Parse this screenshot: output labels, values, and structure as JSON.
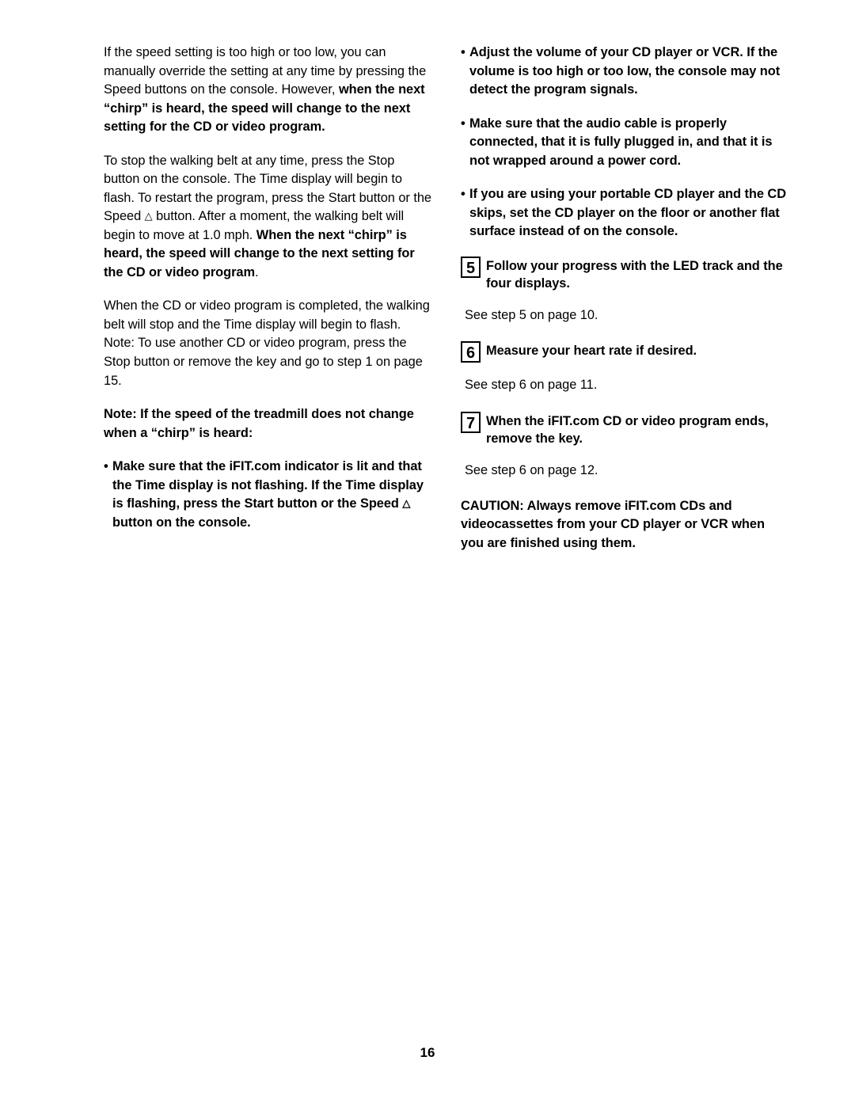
{
  "page": {
    "number": "16"
  },
  "left_column": {
    "para1_part1": "If the speed setting is too high or too low, you can manually override the setting at any time by pressing the Speed buttons on the console. However, ",
    "para1_bold": "when the next “chirp” is heard, the speed will change to the next setting for the CD or video program.",
    "para2_part1": "To stop the walking belt at any time, press the Stop button on the console. The Time display will begin to flash. To restart the program, press the Start button or the Speed ",
    "para2_tri": "△",
    "para2_part2": " button. After a moment, the walking belt will begin to move at 1.0 mph. ",
    "para2_bold": "When the next “chirp” is heard, the speed will change to the next setting for the CD or video program",
    "para2_end": ".",
    "para3": "When the CD or video program is completed, the walking belt will stop and the Time display will begin to flash. Note: To use another CD or video program, press the Stop button or remove the key and go to step 1 on page 15.",
    "note_heading": "Note: If the speed of the treadmill does not change when a “chirp” is heard:",
    "bullet_dot": "•",
    "bullet1_part1": "Make sure that the iFIT.com indicator is lit and that the Time display is not flashing. If the Time display is flashing, press the Start button or the Speed ",
    "bullet1_tri": "△",
    "bullet1_part2": " button on the console."
  },
  "right_column": {
    "bullet_dot": "•",
    "bullet1": "Adjust the volume of your CD player or VCR. If the volume is too high or too low, the console may not detect the program signals.",
    "bullet2": "Make sure that the audio cable is properly connected, that it is fully plugged in, and that it is not wrapped around a power cord.",
    "bullet3": "If you are using your portable CD player and the CD skips, set the CD player on the floor or another flat surface instead of on the console.",
    "step5_num": "5",
    "step5_text": "Follow your progress with the LED track and the four displays.",
    "step5_ref": "See step 5 on page 10.",
    "step6_num": "6",
    "step6_text": "Measure your heart rate if desired.",
    "step6_ref": "See step 6 on page 11.",
    "step7_num": "7",
    "step7_text": "When the iFIT.com CD or video program ends, remove the key.",
    "step7_ref": "See step 6 on page 12.",
    "caution": "CAUTION: Always remove iFIT.com CDs and videocassettes from your CD player or VCR when you are finished using them."
  }
}
